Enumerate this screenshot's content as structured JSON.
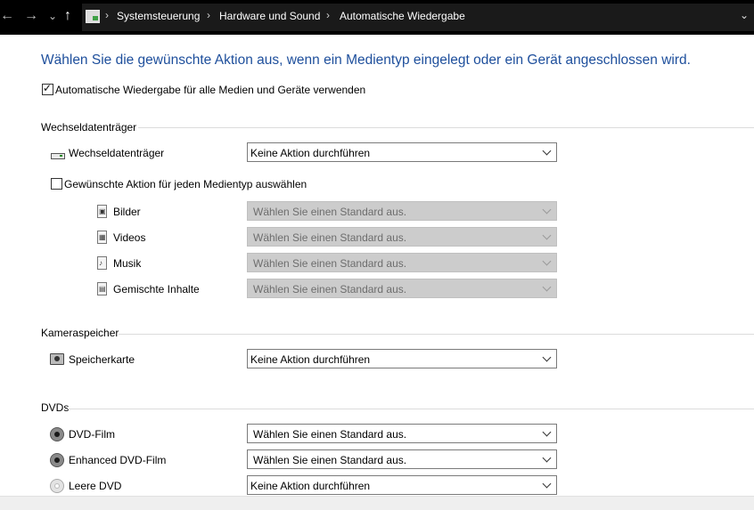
{
  "address_bar": {
    "crumbs": [
      "Systemsteuerung",
      "Hardware und Sound",
      "Automatische Wiedergabe"
    ],
    "separator": "›",
    "dropdown": "⌄"
  },
  "nav": {
    "back": "←",
    "forward": "→",
    "recent": "⌄",
    "up": "↑"
  },
  "heading": "Wählen Sie die gewünschte Aktion aus, wenn ein Medientyp eingelegt oder ein Gerät angeschlossen wird.",
  "autoplay_all_label": "Automatische Wiedergabe für alle Medien und Geräte verwenden",
  "autoplay_all_checked": true,
  "removable": {
    "title": "Wechseldatenträger",
    "device_label": "Wechseldatenträger",
    "device_value": "Keine Aktion durchführen",
    "per_media_label": "Gewünschte Aktion für jeden Medientyp auswählen",
    "per_media_checked": false,
    "media": [
      {
        "label": "Bilder",
        "value": "Wählen Sie einen Standard aus."
      },
      {
        "label": "Videos",
        "value": "Wählen Sie einen Standard aus."
      },
      {
        "label": "Musik",
        "value": "Wählen Sie einen Standard aus."
      },
      {
        "label": "Gemischte Inhalte",
        "value": "Wählen Sie einen Standard aus."
      }
    ]
  },
  "camera": {
    "title": "Kameraspeicher",
    "label": "Speicherkarte",
    "value": "Keine Aktion durchführen"
  },
  "dvds": {
    "title": "DVDs",
    "items": [
      {
        "label": "DVD-Film",
        "value": "Wählen Sie einen Standard aus."
      },
      {
        "label": "Enhanced DVD-Film",
        "value": "Wählen Sie einen Standard aus."
      },
      {
        "label": "Leere DVD",
        "value": "Keine Aktion durchführen"
      }
    ]
  },
  "icons": {
    "drive": "drive-icon",
    "picture": "picture-file-icon",
    "video": "video-file-icon",
    "music": "music-file-icon",
    "mixed": "mixed-content-file-icon",
    "card": "memory-card-icon",
    "dvd": "dvd-disc-icon",
    "blank_dvd": "blank-dvd-icon"
  },
  "colors": {
    "heading": "#1e4f9c",
    "title_bar": "#000000"
  }
}
